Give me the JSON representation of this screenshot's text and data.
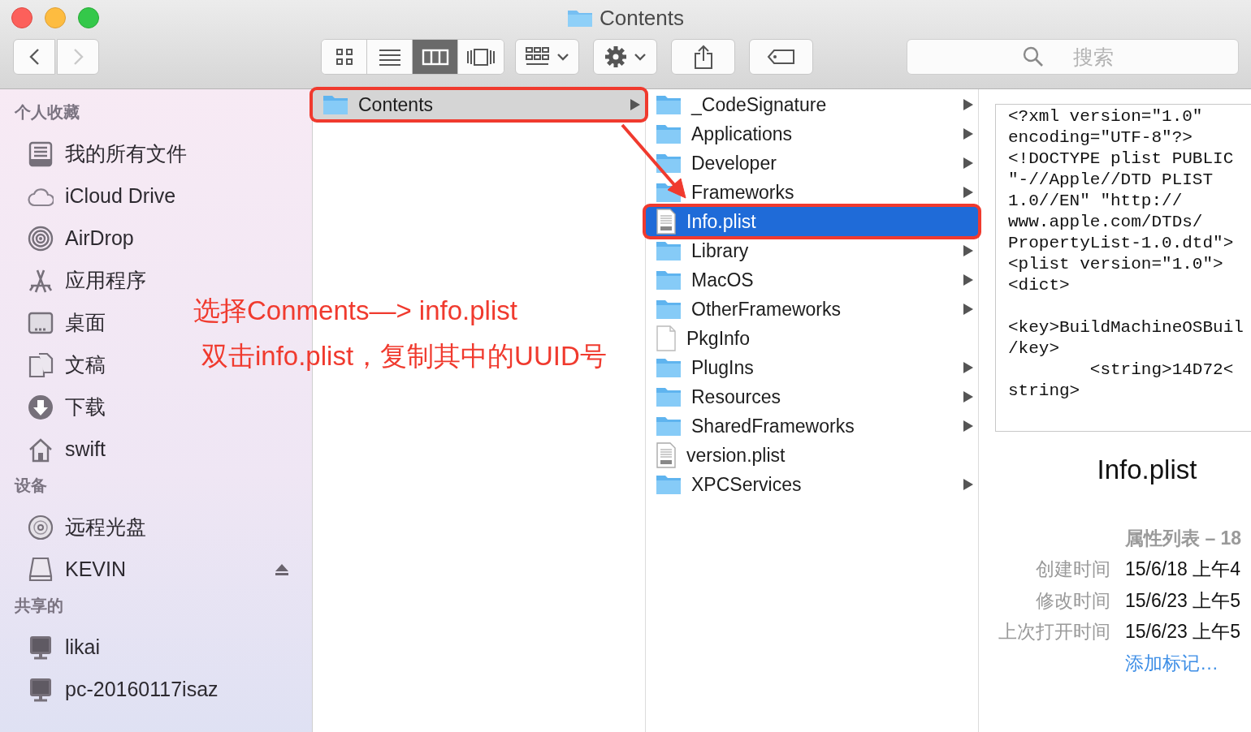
{
  "window": {
    "title": "Contents"
  },
  "toolbar": {
    "nav": [
      {
        "kind": "back",
        "disabled": false
      },
      {
        "kind": "forward",
        "disabled": true
      }
    ],
    "views": [
      {
        "kind": "icons",
        "selected": false
      },
      {
        "kind": "list",
        "selected": false
      },
      {
        "kind": "columns",
        "selected": true
      },
      {
        "kind": "coverflow",
        "selected": false
      }
    ],
    "search": {
      "placeholder": "搜索"
    }
  },
  "sidebar": {
    "sections": [
      {
        "heading": "个人收藏",
        "items": [
          {
            "label": "我的所有文件",
            "kind": "tray"
          },
          {
            "label": "iCloud Drive",
            "kind": "cloud"
          },
          {
            "label": "AirDrop",
            "kind": "airdrop"
          },
          {
            "label": "应用程序",
            "kind": "apps"
          },
          {
            "label": "桌面",
            "kind": "desktop"
          },
          {
            "label": "文稿",
            "kind": "docs"
          },
          {
            "label": "下载",
            "kind": "download"
          },
          {
            "label": "swift",
            "kind": "home"
          }
        ]
      },
      {
        "heading": "设备",
        "items": [
          {
            "label": "远程光盘",
            "kind": "disc",
            "eject": false
          },
          {
            "label": "KEVIN",
            "kind": "drive",
            "eject": true
          }
        ]
      },
      {
        "heading": "共享的",
        "items": [
          {
            "label": "likai",
            "kind": "computer"
          },
          {
            "label": "pc-20160117isaz",
            "kind": "computer"
          }
        ]
      }
    ]
  },
  "columns": [
    {
      "focused": false,
      "items": [
        {
          "name": "Contents",
          "kind": "folder",
          "selected": true,
          "expandable": true,
          "callout": true
        }
      ]
    },
    {
      "focused": true,
      "items": [
        {
          "name": "_CodeSignature",
          "kind": "folder",
          "selected": false,
          "expandable": true,
          "callout": false
        },
        {
          "name": "Applications",
          "kind": "folder",
          "selected": false,
          "expandable": true,
          "callout": false
        },
        {
          "name": "Developer",
          "kind": "folder",
          "selected": false,
          "expandable": true,
          "callout": false
        },
        {
          "name": "Frameworks",
          "kind": "folder",
          "selected": false,
          "expandable": true,
          "callout": false
        },
        {
          "name": "Info.plist",
          "kind": "plist",
          "selected": true,
          "expandable": false,
          "callout": true
        },
        {
          "name": "Library",
          "kind": "folder",
          "selected": false,
          "expandable": true,
          "callout": false
        },
        {
          "name": "MacOS",
          "kind": "folder",
          "selected": false,
          "expandable": true,
          "callout": false
        },
        {
          "name": "OtherFrameworks",
          "kind": "folder",
          "selected": false,
          "expandable": true,
          "callout": false
        },
        {
          "name": "PkgInfo",
          "kind": "file",
          "selected": false,
          "expandable": false,
          "callout": false
        },
        {
          "name": "PlugIns",
          "kind": "folder",
          "selected": false,
          "expandable": true,
          "callout": false
        },
        {
          "name": "Resources",
          "kind": "folder",
          "selected": false,
          "expandable": true,
          "callout": false
        },
        {
          "name": "SharedFrameworks",
          "kind": "folder",
          "selected": false,
          "expandable": true,
          "callout": false
        },
        {
          "name": "version.plist",
          "kind": "plist",
          "selected": false,
          "expandable": false,
          "callout": false
        },
        {
          "name": "XPCServices",
          "kind": "folder",
          "selected": false,
          "expandable": true,
          "callout": false
        }
      ]
    }
  ],
  "preview": {
    "code_blocks": [
      [
        "<?xml version=\"1.0\"",
        "encoding=\"UTF-8\"?>",
        "<!DOCTYPE plist PUBLIC",
        "\"-//Apple//DTD PLIST",
        "1.0//EN\" \"http://",
        "www.apple.com/DTDs/",
        "PropertyList-1.0.dtd\">",
        "<plist version=\"1.0\">",
        "<dict>"
      ],
      [
        "<key>BuildMachineOSBuil",
        "/key>",
        "        <string>14D72<",
        "string>"
      ]
    ],
    "filename": "Info.plist",
    "kind_text": "属性列表 – 18",
    "meta": [
      {
        "label": "创建时间",
        "value": "15/6/18 上午4"
      },
      {
        "label": "修改时间",
        "value": "15/6/23 上午5"
      },
      {
        "label": "上次打开时间",
        "value": "15/6/23 上午5"
      }
    ],
    "tag_link": "添加标记…"
  },
  "annotations": [
    "选择Conments—> info.plist",
    "双击info.plist，复制其中的UUID号"
  ]
}
